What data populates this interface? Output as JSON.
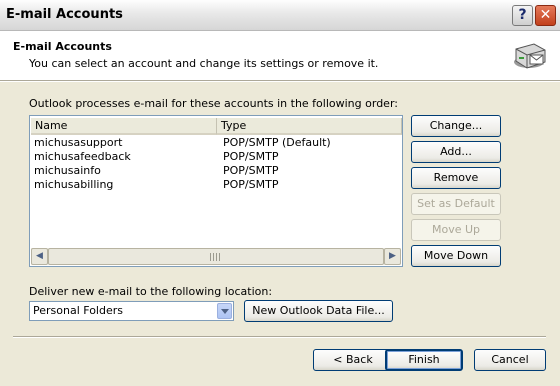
{
  "window": {
    "title": "E-mail Accounts",
    "help_glyph": "?",
    "close_glyph": "✕"
  },
  "header": {
    "title": "E-mail Accounts",
    "subtitle": "You can select an account and change its settings or remove it.",
    "icon": "mail-accounts-icon"
  },
  "accounts": {
    "order_label": "Outlook processes e-mail for these accounts in the following order:",
    "columns": [
      "Name",
      "Type"
    ],
    "rows": [
      {
        "name": "michusasupport",
        "type": "POP/SMTP (Default)"
      },
      {
        "name": "michusafeedback",
        "type": "POP/SMTP"
      },
      {
        "name": "michusainfo",
        "type": "POP/SMTP"
      },
      {
        "name": "michusabilling",
        "type": "POP/SMTP"
      }
    ]
  },
  "side_buttons": {
    "change": "Change...",
    "add": "Add...",
    "remove": "Remove",
    "set_default": "Set as Default",
    "move_up": "Move Up",
    "move_down": "Move Down"
  },
  "delivery": {
    "label": "Deliver new e-mail to the following location:",
    "selected": "Personal Folders",
    "new_file_button": "New Outlook Data File..."
  },
  "footer": {
    "back": "< Back",
    "finish": "Finish",
    "cancel": "Cancel"
  },
  "colors": {
    "dialog_bg": "#ece9d8",
    "button_border": "#003c74",
    "close_button": "#c2401c"
  }
}
